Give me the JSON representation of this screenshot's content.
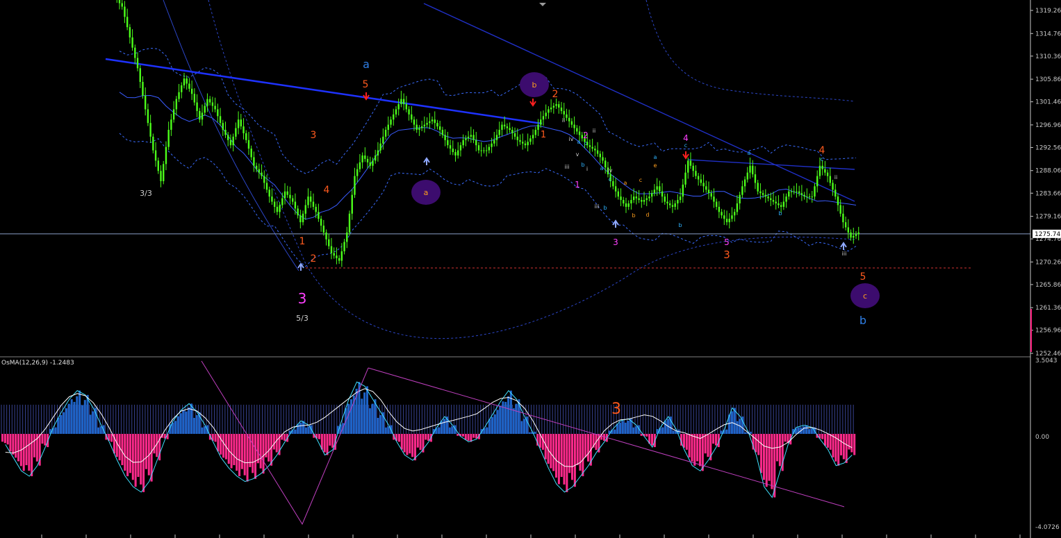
{
  "chart_data": [
    {
      "type": "candlestick",
      "ylim": [
        1252.46,
        1321.0
      ],
      "y_ticks": [
        "1319.26",
        "1314.76",
        "1310.36",
        "1305.86",
        "1301.46",
        "1296.96",
        "1292.56",
        "1288.06",
        "1283.66",
        "1279.16",
        "1274.76",
        "1270.26",
        "1265.86",
        "1261.36",
        "1256.96",
        "1252.46"
      ],
      "current_price": "1275.74",
      "series": [
        {
          "values": [
            1320.0,
            1314.0,
            1308.0,
            1300.0,
            1292.0,
            1286.0,
            1296.0,
            1302.0,
            1306.0,
            1303.0,
            1298.0,
            1302.0,
            1300.0,
            1296.0,
            1293.0,
            1298.0,
            1294.0,
            1289.0,
            1287.0,
            1283.0,
            1280.0,
            1284.0,
            1282.0,
            1278.0,
            1283.0,
            1280.0,
            1276.0,
            1272.0,
            1270.5,
            1276.0,
            1287.0,
            1291.0,
            1289.0,
            1292.0,
            1296.0,
            1299.0,
            1302.0,
            1299.0,
            1296.0,
            1297.0,
            1298.0,
            1296.0,
            1293.0,
            1291.0,
            1294.0,
            1295.0,
            1292.0,
            1292.0,
            1294.0,
            1297.0,
            1296.0,
            1294.0,
            1293.0,
            1295.0,
            1298.0,
            1300.0,
            1301.0,
            1299.0,
            1297.0,
            1295.0,
            1293.0,
            1292.0,
            1290.0,
            1286.0,
            1283.0,
            1281.0,
            1283.0,
            1282.0,
            1283.0,
            1285.0,
            1282.0,
            1281.0,
            1283.0,
            1290.0,
            1287.0,
            1285.0,
            1283.0,
            1280.0,
            1278.0,
            1280.0,
            1285.0,
            1289.0,
            1284.0,
            1283.0,
            1282.0,
            1281.0,
            1284.0,
            1284.0,
            1283.0,
            1283.0,
            1289.0,
            1287.0,
            1283.0,
            1278.0,
            1275.0,
            1276.0
          ]
        }
      ]
    },
    {
      "type": "histogram",
      "title": "OsMA(12,26,9) -1.2483",
      "ylim": [
        -4.0726,
        3.5043
      ],
      "y_ticks": [
        "3.5043",
        "0.00",
        "-4.0726"
      ],
      "series": [
        {
          "values": [
            -0.4,
            -0.9,
            -1.4,
            -1.6,
            -1.2,
            -0.5,
            0.3,
            1.0,
            1.6,
            2.0,
            1.8,
            1.2,
            0.4,
            -0.3,
            -1.0,
            -1.6,
            -2.0,
            -2.2,
            -1.8,
            -1.0,
            -0.2,
            0.6,
            1.1,
            1.4,
            1.0,
            0.4,
            -0.3,
            -0.9,
            -1.3,
            -1.6,
            -1.8,
            -1.7,
            -1.5,
            -1.2,
            -0.8,
            -0.3,
            0.2,
            0.6,
            0.4,
            -0.2,
            -0.8,
            -0.6,
            0.5,
            1.6,
            2.4,
            2.2,
            1.6,
            1.0,
            0.4,
            -0.3,
            -0.8,
            -1.0,
            -0.7,
            -0.3,
            0.3,
            0.8,
            0.4,
            -0.1,
            -0.3,
            -0.2,
            0.3,
            0.9,
            1.5,
            2.0,
            1.6,
            0.8,
            0.1,
            -0.6,
            -1.3,
            -1.9,
            -2.2,
            -2.0,
            -1.6,
            -1.2,
            -0.7,
            -0.3,
            0.2,
            0.6,
            0.7,
            0.4,
            -0.1,
            -0.5,
            0.3,
            0.8,
            0.2,
            -0.6,
            -1.2,
            -1.4,
            -1.0,
            -0.5,
            0.2,
            1.2,
            0.8,
            0.1,
            -0.8,
            -2.0,
            -2.4,
            -1.4,
            -0.4,
            0.3,
            0.4,
            0.3,
            -0.2,
            -0.6,
            -1.2,
            -1.1,
            -0.8
          ]
        }
      ]
    }
  ],
  "annotations": {
    "primary_top": [
      {
        "label": "a",
        "color": "#2f7fe6"
      },
      {
        "label": "5",
        "color": "#ff5a1e"
      },
      {
        "label": "3",
        "color": "#ff5a1e"
      },
      {
        "label": "4",
        "color": "#ff5a1e"
      },
      {
        "label": "2",
        "color": "#ff5a1e"
      },
      {
        "label": "1",
        "color": "#ff5a1e"
      },
      {
        "label": "4",
        "color": "#ff40ff"
      },
      {
        "label": "4",
        "color": "#ff5a1e"
      },
      {
        "label": "2",
        "color": "#ff40ff"
      }
    ],
    "primary_bottom": [
      {
        "label": "3/3",
        "color": "#d0d0d0"
      },
      {
        "label": "1",
        "color": "#ff5a1e"
      },
      {
        "label": "2",
        "color": "#ff5a1e"
      },
      {
        "label": "3",
        "color": "#ff40ff"
      },
      {
        "label": "5/3",
        "color": "#d0d0d0"
      },
      {
        "label": "3",
        "color": "#ff40ff"
      },
      {
        "label": "1",
        "color": "#ff40ff"
      },
      {
        "label": "5",
        "color": "#ff40ff"
      },
      {
        "label": "3",
        "color": "#ff5a1e"
      },
      {
        "label": "5",
        "color": "#ff5a1e"
      },
      {
        "label": "b",
        "color": "#2f7fe6"
      }
    ],
    "circles": [
      {
        "label": "a"
      },
      {
        "label": "b"
      },
      {
        "label": "c"
      }
    ],
    "small": [
      {
        "label": "ii",
        "color": "#d0d0d0"
      },
      {
        "label": "iv",
        "color": "#d0d0d0"
      },
      {
        "label": "iii",
        "color": "#d0d0d0"
      },
      {
        "label": "v",
        "color": "#d0d0d0"
      },
      {
        "label": "a",
        "color": "#2fb4ff"
      },
      {
        "label": "c",
        "color": "#2fb4ff"
      },
      {
        "label": "b",
        "color": "#2fb4ff"
      },
      {
        "label": "i",
        "color": "#d0d0d0"
      },
      {
        "label": "ii",
        "color": "#d0d0d0"
      },
      {
        "label": "a",
        "color": "#2fb4ff"
      },
      {
        "label": "iv",
        "color": "#d0d0d0"
      },
      {
        "label": "c",
        "color": "#2fb4ff"
      },
      {
        "label": "iii",
        "color": "#d0d0d0"
      },
      {
        "label": "b",
        "color": "#2fb4ff"
      },
      {
        "label": "a",
        "color": "#ff9f1e"
      },
      {
        "label": "b",
        "color": "#ff9f1e"
      },
      {
        "label": "c",
        "color": "#ff9f1e"
      },
      {
        "label": "d",
        "color": "#ff9f1e"
      },
      {
        "label": "a",
        "color": "#2fb4ff"
      },
      {
        "label": "e",
        "color": "#ff9f1e"
      },
      {
        "label": "c",
        "color": "#2fb4ff"
      },
      {
        "label": "b",
        "color": "#2fb4ff"
      },
      {
        "label": "a",
        "color": "#2fb4ff"
      },
      {
        "label": "b",
        "color": "#2fb4ff"
      },
      {
        "label": "c",
        "color": "#2fb4ff"
      },
      {
        "label": "ii",
        "color": "#d0d0d0"
      },
      {
        "label": "iii",
        "color": "#d0d0d0"
      }
    ],
    "osma_label": {
      "label": "3",
      "color": "#ff5a1e"
    }
  }
}
